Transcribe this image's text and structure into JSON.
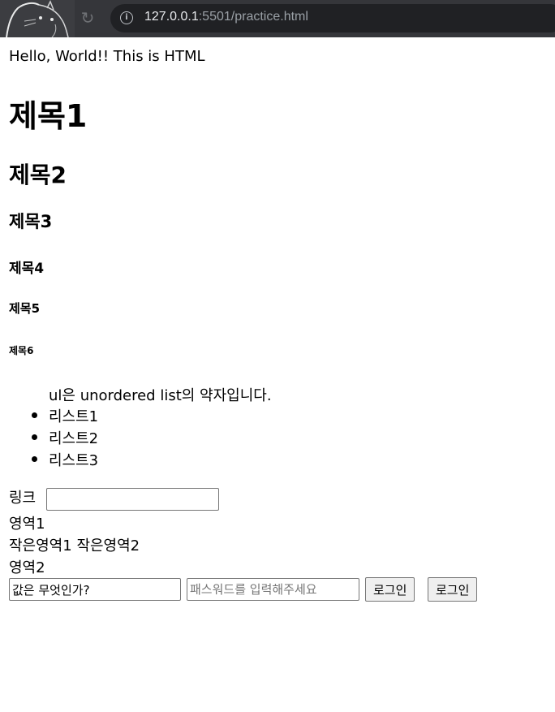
{
  "browser": {
    "url_host": "127.0.0.1",
    "url_rest": ":5501/practice.html",
    "reload_icon": "reload-icon",
    "info_icon": "info-icon"
  },
  "page": {
    "intro": "Hello, World!! This is HTML",
    "headings": [
      "제목1",
      "제목2",
      "제목3",
      "제목4",
      "제목5",
      "제목6"
    ],
    "ul_caption": "ul은 unordered list의 약자입니다.",
    "list_items": [
      "리스트1",
      "리스트2",
      "리스트3"
    ],
    "link_label": "링크",
    "link_input_value": "",
    "area1": "영역1",
    "small_area1": "작은영역1",
    "small_area2": "작은영역2",
    "area2": "영역2",
    "value_input": "값은 무엇인가?",
    "password_placeholder": "패스워드를 입력해주세요",
    "login_button1": "로그인",
    "login_button2": "로그인"
  }
}
